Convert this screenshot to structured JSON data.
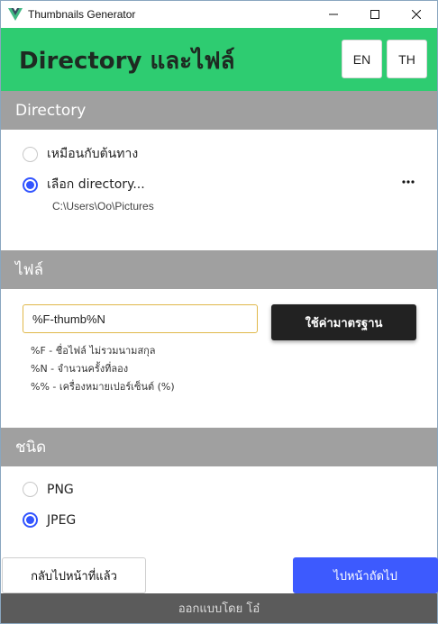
{
  "window": {
    "title": "Thumbnails Generator",
    "icon": "vue-logo-icon",
    "controls": [
      "minimize-icon",
      "maximize-icon",
      "close-icon"
    ]
  },
  "header": {
    "title": "Directory และไฟล์",
    "lang_en": "EN",
    "lang_th": "TH",
    "accent_color": "#2ecc71"
  },
  "directory": {
    "heading": "Directory",
    "options": [
      {
        "label": "เหมือนกับต้นทาง",
        "selected": false
      },
      {
        "label": "เลือก directory...",
        "selected": true
      }
    ],
    "path": "C:\\Users\\Oo\\Pictures",
    "more_icon": "more-horizontal-icon"
  },
  "file": {
    "heading": "ไฟล์",
    "name_value": "%F-thumb%N",
    "default_label": "ใช้ค่ามาตรฐาน",
    "hints": [
      "%F - ชื่อไฟล์ ไม่รวมนามสกุล",
      "%N - จำนวนครั้งที่ลอง",
      "%% - เครื่องหมายเปอร์เซ็นต์ (%)"
    ]
  },
  "type": {
    "heading": "ชนิด",
    "options": [
      {
        "label": "PNG",
        "selected": false
      },
      {
        "label": "JPEG",
        "selected": true
      }
    ]
  },
  "nav": {
    "back_label": "กลับไปหน้าที่แล้ว",
    "next_label": "ไปหน้าถัดไป",
    "next_color": "#3d5afe"
  },
  "footer": {
    "text": "ออกแบบโดย โอ๋"
  }
}
